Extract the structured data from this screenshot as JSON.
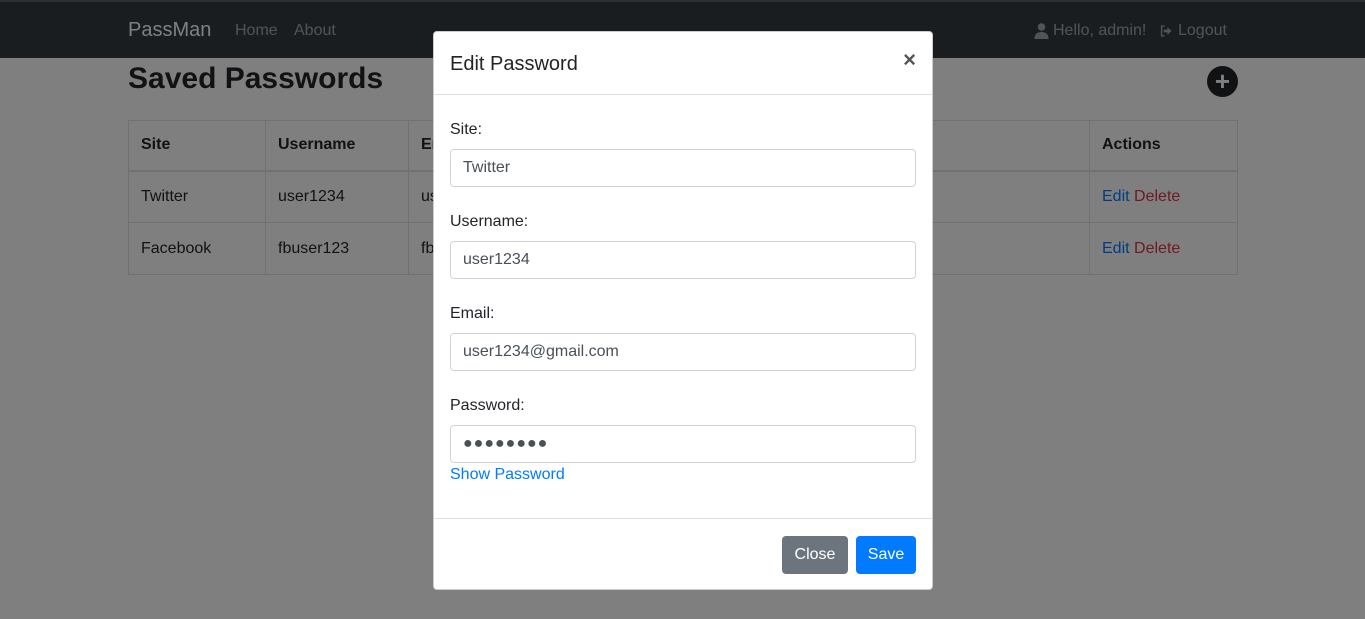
{
  "navbar": {
    "brand": "PassMan",
    "links": [
      "Home",
      "About"
    ],
    "greeting": "Hello, admin!",
    "logout": "Logout"
  },
  "page": {
    "title": "Saved Passwords",
    "add_icon": "plus-circle-icon"
  },
  "table": {
    "headers": [
      "Site",
      "Username",
      "Em",
      "Actions"
    ],
    "rows": [
      {
        "site": "Twitter",
        "username": "user1234",
        "email": "us",
        "edit": "Edit",
        "delete": "Delete"
      },
      {
        "site": "Facebook",
        "username": "fbuser123",
        "email": "fb",
        "edit": "Edit",
        "delete": "Delete"
      }
    ]
  },
  "modal": {
    "title": "Edit Password",
    "close_symbol": "×",
    "site_label": "Site:",
    "site_value": "Twitter",
    "username_label": "Username:",
    "username_value": "user1234",
    "email_label": "Email:",
    "email_value": "user1234@gmail.com",
    "password_label": "Password:",
    "password_value": "●●●●●●●●",
    "show_password": "Show Password",
    "close_button": "Close",
    "save_button": "Save"
  },
  "colors": {
    "navbar": "#343a40",
    "primary": "#007bff",
    "danger": "#dc3545",
    "secondary": "#6c757d"
  }
}
